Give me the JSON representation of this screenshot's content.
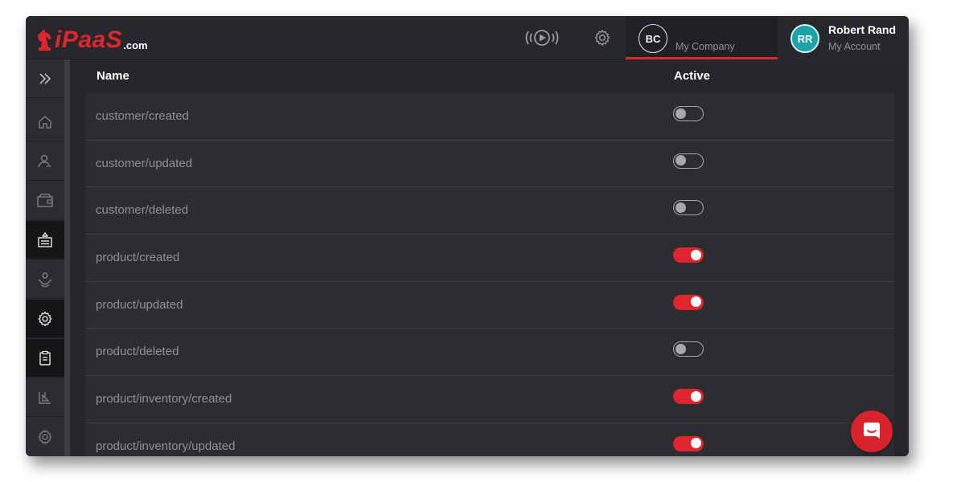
{
  "logo": {
    "word": "iPaaS",
    "suffix": ".com"
  },
  "header": {
    "icons": [
      "broadcast-play-icon",
      "gear-icon"
    ],
    "company": {
      "initials": "BC",
      "name": "My Company"
    },
    "account": {
      "initials": "RR",
      "user_name": "Robert Rand",
      "label": "My Account"
    }
  },
  "sidebar": {
    "items": [
      {
        "icon": "expand-chevrons-icon",
        "active": false
      },
      {
        "icon": "home-icon",
        "active": false
      },
      {
        "icon": "users-icon",
        "active": false
      },
      {
        "icon": "wallet-icon",
        "active": false
      },
      {
        "icon": "integrations-icon",
        "active": true
      },
      {
        "icon": "hand-support-icon",
        "active": false
      },
      {
        "icon": "settings-gear-icon",
        "active": true
      },
      {
        "icon": "clipboard-icon",
        "active": true
      },
      {
        "icon": "reports-icon",
        "active": false
      },
      {
        "icon": "gear-icon",
        "active": false
      }
    ]
  },
  "table": {
    "columns": [
      "Name",
      "Active"
    ],
    "rows": [
      {
        "name": "customer/created",
        "active": false
      },
      {
        "name": "customer/updated",
        "active": false
      },
      {
        "name": "customer/deleted",
        "active": false
      },
      {
        "name": "product/created",
        "active": true
      },
      {
        "name": "product/updated",
        "active": true
      },
      {
        "name": "product/deleted",
        "active": false
      },
      {
        "name": "product/inventory/created",
        "active": true
      },
      {
        "name": "product/inventory/updated",
        "active": true
      }
    ]
  },
  "colors": {
    "accent": "#e0252e",
    "avatar_teal": "#1ba3a8",
    "background": "#25272a"
  },
  "chat_fab": {
    "icon": "chat-bubble-icon"
  }
}
